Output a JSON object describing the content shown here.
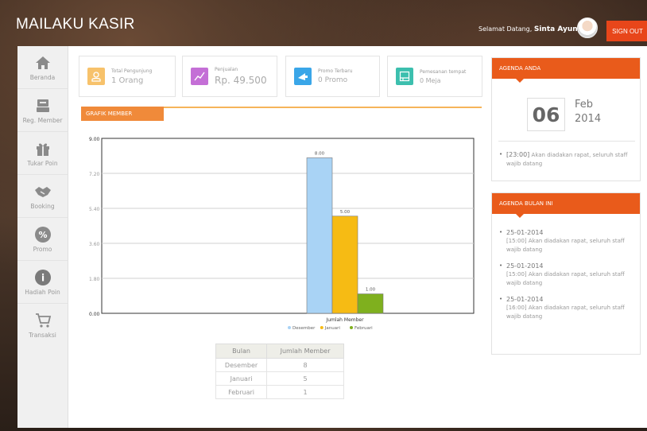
{
  "header": {
    "brand": "MAILAKU KASIR",
    "welcome_prefix": "Selamat Datang,",
    "user_name": "Sinta Ayuni",
    "signout_label": "SIGN OUT",
    "accent": "#e8461a"
  },
  "sidebar": {
    "items": [
      {
        "label": "Beranda",
        "icon": "home-icon"
      },
      {
        "label": "Reg. Member",
        "icon": "member-icon"
      },
      {
        "label": "Tukar Poin",
        "icon": "gift-icon"
      },
      {
        "label": "Booking",
        "icon": "handshake-icon"
      },
      {
        "label": "Promo",
        "icon": "percent-icon"
      },
      {
        "label": "Hadiah Poin",
        "icon": "info-icon"
      },
      {
        "label": "Transaksi",
        "icon": "cart-icon"
      }
    ]
  },
  "stats": [
    {
      "title": "Total Pengunjung",
      "value": "1 Orang",
      "color": "#f7c26b",
      "icon": "user-icon"
    },
    {
      "title": "Penjualan",
      "value": "Rp. 49.500",
      "color": "#c46fd6",
      "icon": "trend-icon"
    },
    {
      "title": "Promo Terbaru",
      "value": "0 Promo",
      "color": "#3aa6e8",
      "icon": "megaphone-icon"
    },
    {
      "title": "Pemesanan tempat",
      "value": "0 Meja",
      "color": "#3cbfae",
      "icon": "table-icon"
    }
  ],
  "grafik_tab": "GRAFIK MEMBER",
  "chart_data": {
    "type": "bar",
    "xlabel": "Jumlah Member",
    "yticks": [
      "9.00",
      "7.20",
      "5.40",
      "3.60",
      "1.80",
      "0.00"
    ],
    "ylim": [
      0,
      9
    ],
    "series": [
      {
        "name": "Desember",
        "value": 8,
        "label": "8.00",
        "color": "#a9d3f5"
      },
      {
        "name": "Januari",
        "value": 5,
        "label": "5.00",
        "color": "#f6bb14"
      },
      {
        "name": "Februari",
        "value": 1,
        "label": "1.00",
        "color": "#7fb01e"
      }
    ],
    "legend": "bottom",
    "grid": true
  },
  "table": {
    "headers": [
      "Bulan",
      "Jumlah Member"
    ],
    "rows": [
      [
        "Desember",
        "8"
      ],
      [
        "Januari",
        "5"
      ],
      [
        "Februari",
        "1"
      ]
    ]
  },
  "agenda_anda": {
    "title": "AGENDA ANDA",
    "day": "06",
    "month": "Feb",
    "year": "2014",
    "item_time": "[23:00]",
    "item_text": "Akan diadakan rapat, seluruh staff wajib datang"
  },
  "agenda_bulan": {
    "title": "AGENDA BULAN INI",
    "items": [
      {
        "date": "25-01-2014",
        "time": "[15:00]",
        "text": "Akan diadakan rapat, seluruh staff wajib datang"
      },
      {
        "date": "25-01-2014",
        "time": "[15:00]",
        "text": "Akan diadakan rapat, seluruh staff wajib datang"
      },
      {
        "date": "25-01-2014",
        "time": "[16:00]",
        "text": "Akan diadakan rapat, seluruh staff wajib datang"
      }
    ]
  }
}
